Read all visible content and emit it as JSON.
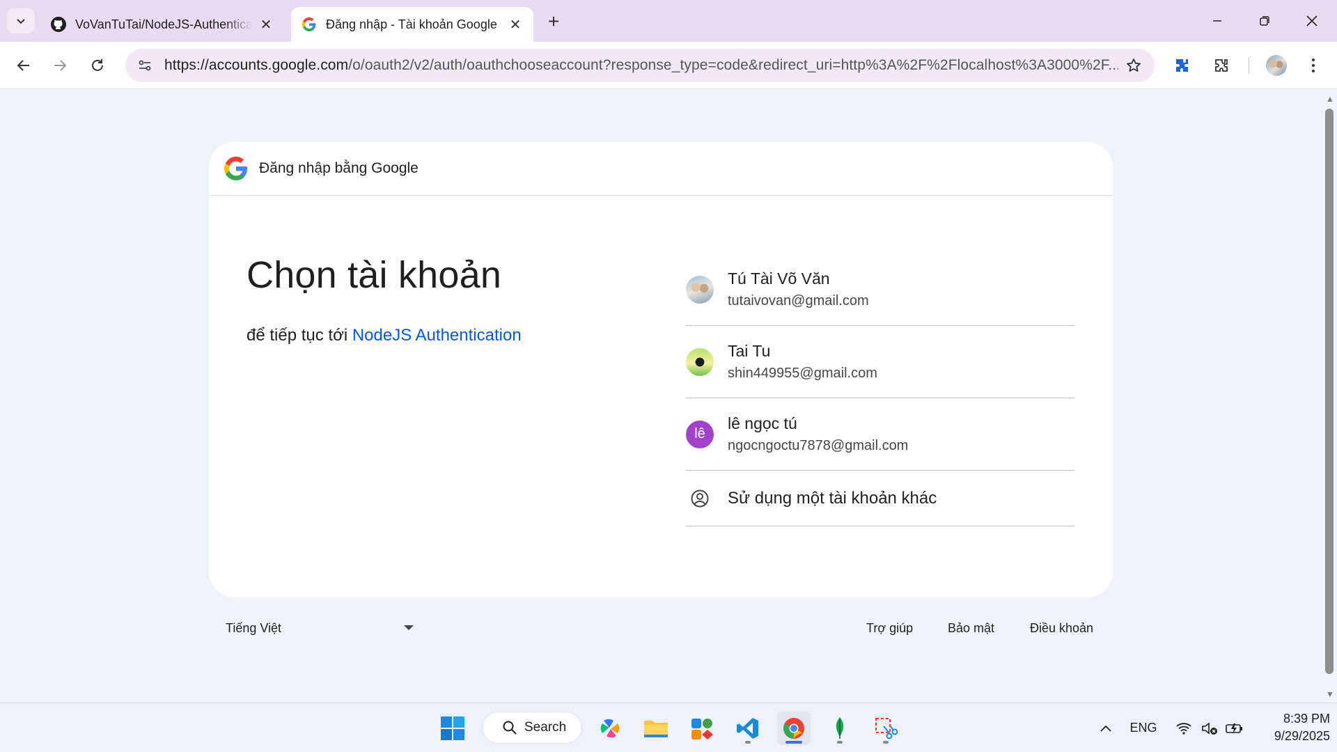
{
  "browser": {
    "tabs": [
      {
        "title": "VoVanTuTai/NodeJS-Authentication",
        "icon": "github-icon",
        "active": false
      },
      {
        "title": "Đăng nhập - Tài khoản Google",
        "icon": "google-icon",
        "active": true
      }
    ],
    "url_host": "https://accounts.google.com",
    "url_rest": "/o/oauth2/v2/auth/oauthchooseaccount?response_type=code&redirect_uri=http%3A%2F%2Flocalhost%3A3000%2F..."
  },
  "card": {
    "header": "Đăng nhập bằng Google",
    "title": "Chọn tài khoản",
    "subtitle_prefix": "để tiếp tục tới ",
    "app_name": "NodeJS Authentication",
    "accounts": [
      {
        "name": "Tú Tài Võ Văn",
        "email": "tutaivovan@gmail.com",
        "avatar": "photo"
      },
      {
        "name": "Tai Tu",
        "email": "shin449955@gmail.com",
        "avatar": "photo"
      },
      {
        "name": "lê ngọc tú",
        "email": "ngocngoctu7878@gmail.com",
        "avatar_letter": "lê",
        "avatar_color": "#a142c8"
      }
    ],
    "other_account": "Sử dụng một tài khoản khác"
  },
  "footer": {
    "language": "Tiếng Việt",
    "links": [
      "Trợ giúp",
      "Bảo mật",
      "Điều khoản"
    ]
  },
  "taskbar": {
    "search_label": "Search",
    "tray_lang": "ENG",
    "time": "8:39 PM",
    "date": "9/29/2025"
  },
  "colors": {
    "link": "#0b57d0",
    "titlebar": "#e9dcf2",
    "page_bg": "#f0f4f9"
  }
}
